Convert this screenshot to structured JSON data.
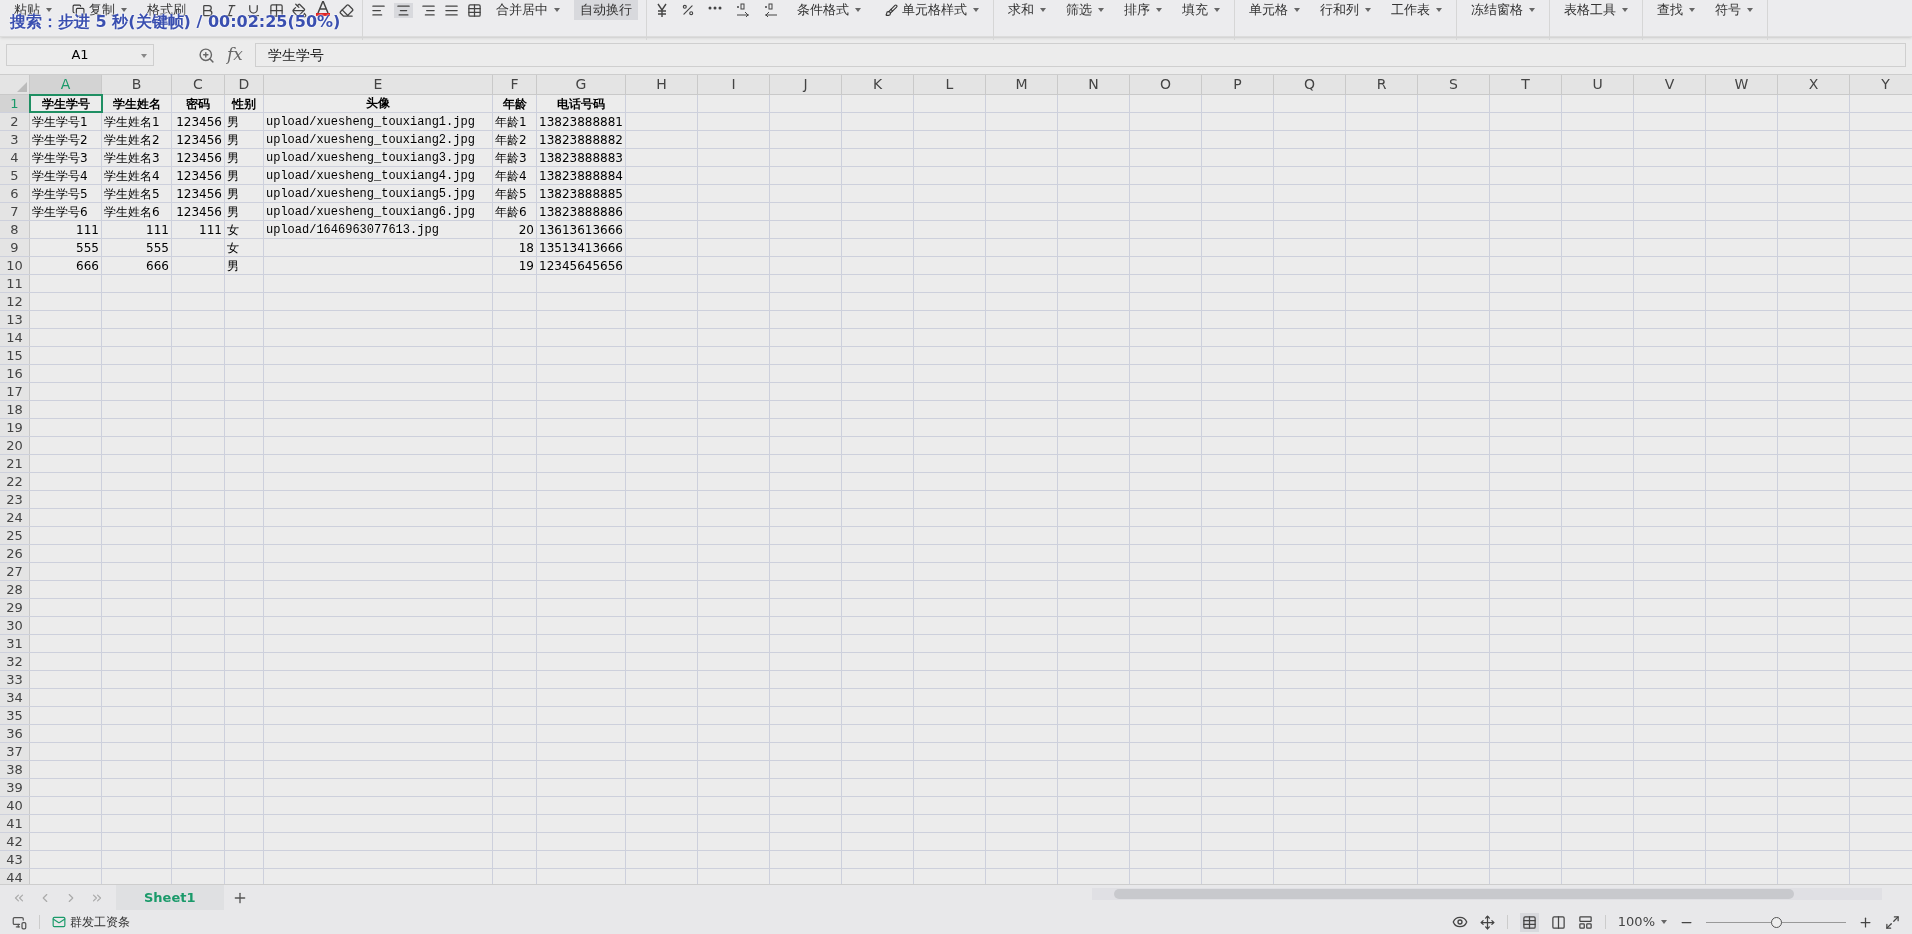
{
  "toolbar": {
    "items": [
      {
        "label": "粘贴",
        "dropdown": true,
        "on": false
      },
      {
        "label": "复制",
        "dropdown": true,
        "on": false
      },
      {
        "label": "格式刷",
        "dropdown": false,
        "on": false
      },
      {
        "label": "合并居中",
        "dropdown": true,
        "on": false
      },
      {
        "label": "自动换行",
        "dropdown": false,
        "on": true
      },
      {
        "label": "条件格式",
        "dropdown": true,
        "on": false
      },
      {
        "label": "单元格样式",
        "dropdown": true,
        "on": false
      },
      {
        "label": "求和",
        "dropdown": true,
        "on": false
      },
      {
        "label": "筛选",
        "dropdown": true,
        "on": false
      },
      {
        "label": "排序",
        "dropdown": true,
        "on": false
      },
      {
        "label": "填充",
        "dropdown": true,
        "on": false
      },
      {
        "label": "单元格",
        "dropdown": true,
        "on": false
      },
      {
        "label": "行和列",
        "dropdown": true,
        "on": false
      },
      {
        "label": "工作表",
        "dropdown": true,
        "on": false
      },
      {
        "label": "冻结窗格",
        "dropdown": true,
        "on": false
      },
      {
        "label": "表格工具",
        "dropdown": true,
        "on": false
      },
      {
        "label": "查找",
        "dropdown": true,
        "on": false
      },
      {
        "label": "符号",
        "dropdown": true,
        "on": false
      }
    ]
  },
  "overlay": "搜索：步进 5 秒(关键帧) / 00:02:25(50%)",
  "formula_bar": {
    "name_box": "A1",
    "fx": "fx",
    "formula": "学生学号"
  },
  "sheet": {
    "columns": [
      {
        "label": "A",
        "selected": true
      },
      {
        "label": "B",
        "selected": false
      },
      {
        "label": "C",
        "selected": false
      },
      {
        "label": "D",
        "selected": false
      },
      {
        "label": "E",
        "selected": false
      },
      {
        "label": "F",
        "selected": false
      },
      {
        "label": "G",
        "selected": false
      },
      {
        "label": "H",
        "selected": false
      },
      {
        "label": "I",
        "selected": false
      },
      {
        "label": "J",
        "selected": false
      },
      {
        "label": "K",
        "selected": false
      },
      {
        "label": "L",
        "selected": false
      },
      {
        "label": "M",
        "selected": false
      },
      {
        "label": "N",
        "selected": false
      },
      {
        "label": "O",
        "selected": false
      },
      {
        "label": "P",
        "selected": false
      },
      {
        "label": "Q",
        "selected": false
      },
      {
        "label": "R",
        "selected": false
      },
      {
        "label": "S",
        "selected": false
      },
      {
        "label": "T",
        "selected": false
      },
      {
        "label": "U",
        "selected": false
      },
      {
        "label": "V",
        "selected": false
      },
      {
        "label": "W",
        "selected": false
      },
      {
        "label": "X",
        "selected": false
      },
      {
        "label": "Y",
        "selected": false
      }
    ],
    "rows": [
      {
        "label": "1",
        "selected": true,
        "kind": "header",
        "cells": [
          "学生学号",
          "学生姓名",
          "密码",
          "性别",
          "头像",
          "年龄",
          "电话号码"
        ]
      },
      {
        "label": "2",
        "selected": false,
        "kind": "data",
        "cells": [
          "学生学号1",
          "学生姓名1",
          "123456",
          "男",
          "upload/xuesheng_touxiang1.jpg",
          "年龄1",
          "13823888881"
        ]
      },
      {
        "label": "3",
        "selected": false,
        "kind": "data",
        "cells": [
          "学生学号2",
          "学生姓名2",
          "123456",
          "男",
          "upload/xuesheng_touxiang2.jpg",
          "年龄2",
          "13823888882"
        ]
      },
      {
        "label": "4",
        "selected": false,
        "kind": "data",
        "cells": [
          "学生学号3",
          "学生姓名3",
          "123456",
          "男",
          "upload/xuesheng_touxiang3.jpg",
          "年龄3",
          "13823888883"
        ]
      },
      {
        "label": "5",
        "selected": false,
        "kind": "data",
        "cells": [
          "学生学号4",
          "学生姓名4",
          "123456",
          "男",
          "upload/xuesheng_touxiang4.jpg",
          "年龄4",
          "13823888884"
        ]
      },
      {
        "label": "6",
        "selected": false,
        "kind": "data",
        "cells": [
          "学生学号5",
          "学生姓名5",
          "123456",
          "男",
          "upload/xuesheng_touxiang5.jpg",
          "年龄5",
          "13823888885"
        ]
      },
      {
        "label": "7",
        "selected": false,
        "kind": "data",
        "cells": [
          "学生学号6",
          "学生姓名6",
          "123456",
          "男",
          "upload/xuesheng_touxiang6.jpg",
          "年龄6",
          "13823888886"
        ]
      },
      {
        "label": "8",
        "selected": false,
        "kind": "data",
        "cells": [
          "111",
          "111",
          "111",
          "女",
          "upload/1646963077613.jpg",
          "20",
          "13613613666"
        ]
      },
      {
        "label": "9",
        "selected": false,
        "kind": "data",
        "cells": [
          "555",
          "555",
          null,
          "女",
          null,
          "18",
          "13513413666"
        ]
      },
      {
        "label": "10",
        "selected": false,
        "kind": "data",
        "cells": [
          "666",
          "666",
          null,
          "男",
          null,
          "19",
          "12345645656"
        ]
      },
      {
        "label": "11",
        "selected": false,
        "kind": "data",
        "cells": []
      },
      {
        "label": "12",
        "selected": false,
        "kind": "data",
        "cells": []
      },
      {
        "label": "13",
        "selected": false,
        "kind": "data",
        "cells": []
      },
      {
        "label": "14",
        "selected": false,
        "kind": "data",
        "cells": []
      },
      {
        "label": "15",
        "selected": false,
        "kind": "data",
        "cells": []
      },
      {
        "label": "16",
        "selected": false,
        "kind": "data",
        "cells": []
      },
      {
        "label": "17",
        "selected": false,
        "kind": "data",
        "cells": []
      },
      {
        "label": "18",
        "selected": false,
        "kind": "data",
        "cells": []
      },
      {
        "label": "19",
        "selected": false,
        "kind": "data",
        "cells": []
      },
      {
        "label": "20",
        "selected": false,
        "kind": "data",
        "cells": []
      },
      {
        "label": "21",
        "selected": false,
        "kind": "data",
        "cells": []
      },
      {
        "label": "22",
        "selected": false,
        "kind": "data",
        "cells": []
      },
      {
        "label": "23",
        "selected": false,
        "kind": "data",
        "cells": []
      },
      {
        "label": "24",
        "selected": false,
        "kind": "data",
        "cells": []
      },
      {
        "label": "25",
        "selected": false,
        "kind": "data",
        "cells": []
      },
      {
        "label": "26",
        "selected": false,
        "kind": "data",
        "cells": []
      },
      {
        "label": "27",
        "selected": false,
        "kind": "data",
        "cells": []
      },
      {
        "label": "28",
        "selected": false,
        "kind": "data",
        "cells": []
      },
      {
        "label": "29",
        "selected": false,
        "kind": "data",
        "cells": []
      },
      {
        "label": "30",
        "selected": false,
        "kind": "data",
        "cells": []
      },
      {
        "label": "31",
        "selected": false,
        "kind": "data",
        "cells": []
      },
      {
        "label": "32",
        "selected": false,
        "kind": "data",
        "cells": []
      },
      {
        "label": "33",
        "selected": false,
        "kind": "data",
        "cells": []
      },
      {
        "label": "34",
        "selected": false,
        "kind": "data",
        "cells": []
      },
      {
        "label": "35",
        "selected": false,
        "kind": "data",
        "cells": []
      },
      {
        "label": "36",
        "selected": false,
        "kind": "data",
        "cells": []
      },
      {
        "label": "37",
        "selected": false,
        "kind": "data",
        "cells": []
      },
      {
        "label": "38",
        "selected": false,
        "kind": "data",
        "cells": []
      },
      {
        "label": "39",
        "selected": false,
        "kind": "data",
        "cells": []
      },
      {
        "label": "40",
        "selected": false,
        "kind": "data",
        "cells": []
      },
      {
        "label": "41",
        "selected": false,
        "kind": "data",
        "cells": []
      },
      {
        "label": "42",
        "selected": false,
        "kind": "data",
        "cells": []
      },
      {
        "label": "43",
        "selected": false,
        "kind": "data",
        "cells": []
      },
      {
        "label": "44",
        "selected": false,
        "kind": "data",
        "cells": []
      }
    ]
  },
  "sheet_tabs": [
    {
      "name": "Sheet1",
      "selected": true
    }
  ],
  "status_bar": {
    "payroll": "群发工资条",
    "zoom": "100%",
    "zoom_slider": {
      "level": 0.5
    }
  }
}
